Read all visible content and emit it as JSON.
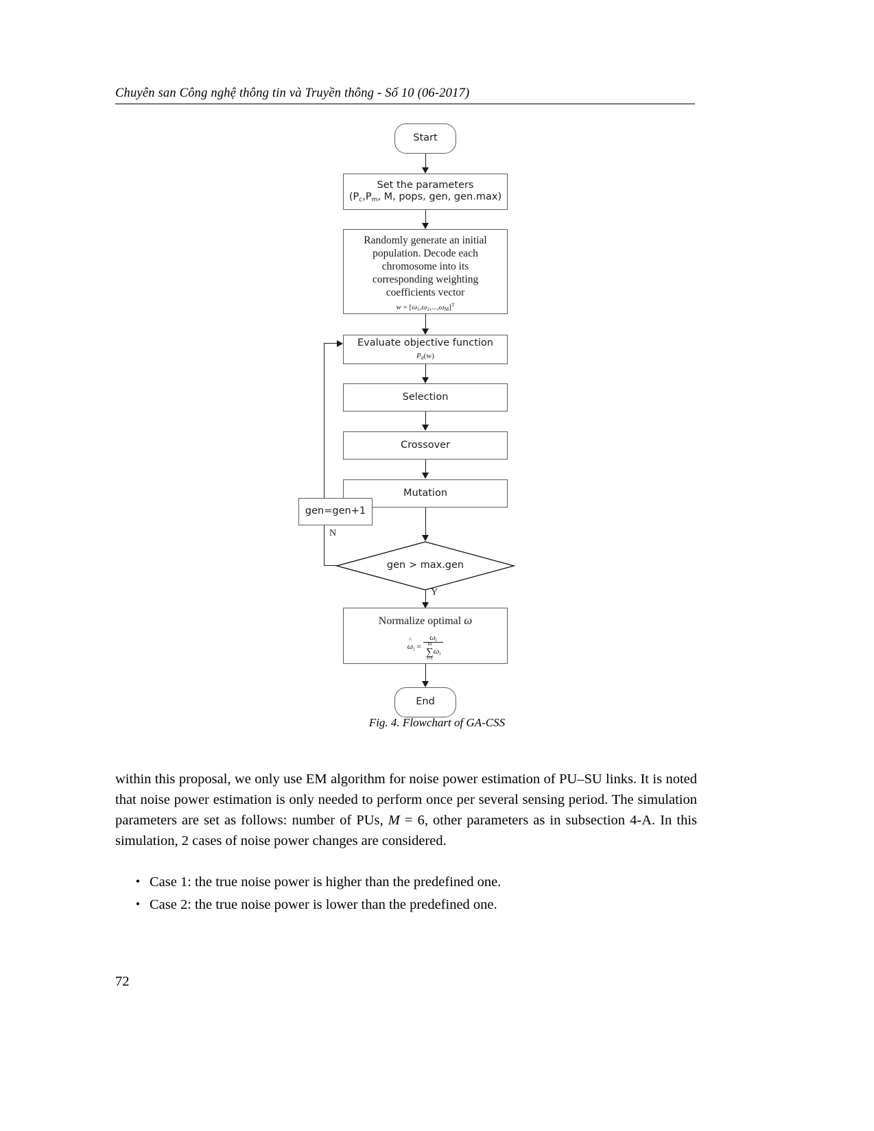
{
  "header": {
    "running_head": "Chuyên san Công nghệ thông tin và Truyền thông - Số 10 (06-2017)"
  },
  "figure": {
    "caption": "Fig. 4. Flowchart of GA-CSS",
    "nodes": {
      "start": "Start",
      "set_parameters_line1": "Set the parameters",
      "set_parameters_line2_prefix": "(P",
      "set_parameters_sub_c": "c",
      "set_parameters_mid": ",P",
      "set_parameters_sub_m": "m",
      "set_parameters_line2_suffix": ", M, pops, gen, gen.max)",
      "randomly_generate_line1": "Randomly generate an initial",
      "randomly_generate_line2": "population. Decode each",
      "randomly_generate_line3": "chromosome into its",
      "randomly_generate_line4": "corresponding weighting",
      "randomly_generate_line5": "coefficients vector",
      "weight_formula": "w = [ω₁, ω₂, ..., ω_M]ᵀ",
      "evaluate": "Evaluate objective function",
      "evaluate_formula": "Pd(w)",
      "selection": "Selection",
      "crossover": "Crossover",
      "mutation": "Mutation",
      "gen_increment": "gen=gen+1",
      "decision": "gen > max.gen",
      "normalize": "Normalize optimal ω",
      "normalize_formula": "ω̂i = ωi / Σ(i=1..M) ωi",
      "end": "End"
    },
    "branch_labels": {
      "no": "N",
      "yes": "Y"
    }
  },
  "body": {
    "paragraph": "within this proposal, we only use EM algorithm for noise power estimation of PU–SU links. It is noted that noise power estimation is only needed to perform once per several sensing period. The simulation parameters are set as follows: number of PUs, M = 6, other parameters as in subsection 4-A. In this simulation, 2 cases of noise power changes are considered.",
    "bullets": [
      "Case 1: the true noise power is higher than the predefined one.",
      "Case 2: the true noise power is lower than the predefined one."
    ],
    "bullet_marker": "•"
  },
  "footer": {
    "page_number": "72"
  }
}
